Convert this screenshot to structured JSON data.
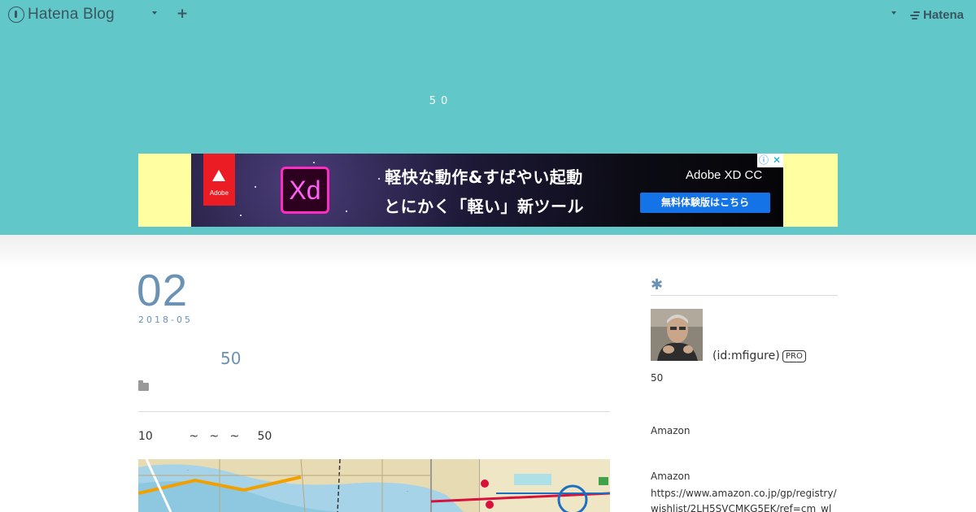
{
  "global_bar": {
    "logo_text": "Hatena Blog",
    "plus_label": "+",
    "hatena_brand": "Hatena"
  },
  "header": {
    "blog_title": "50"
  },
  "ad": {
    "adobe_word": "Adobe",
    "xd_label": "Xd",
    "line1": "軽快な動作&すばやい起動",
    "line2": "とにかく「軽い」新ツール",
    "brand": "Adobe XD CC",
    "cta": "無料体験版はこちら",
    "info_glyph": "ⓘ",
    "close_glyph": "✕"
  },
  "entry": {
    "day": "02",
    "year_month": "2018-05",
    "title": "50",
    "body_text": "10          ~   ~   ~     50"
  },
  "sidebar": {
    "heading_icon": "✱",
    "profile_id": "(id:mfigure)",
    "pro_badge": "PRO",
    "desc": "50",
    "amazon_heading": "Amazon",
    "amazon_label": "Amazon",
    "amazon_url": "https://www.amazon.co.jp/gp/registry/wishlist/2LH5SVCMKG5EK/ref=cm_wl_"
  },
  "colors": {
    "header_bg": "#61c7c8",
    "accent": "#6b92b4",
    "ad_frame": "#ffffa1"
  }
}
